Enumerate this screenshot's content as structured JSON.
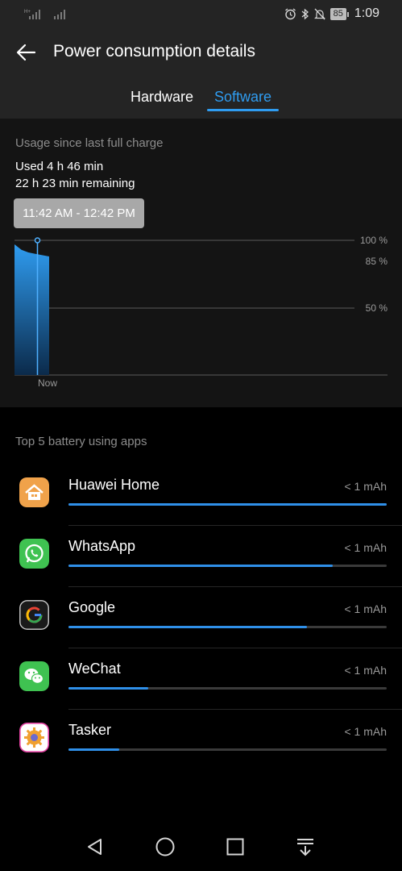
{
  "status_bar": {
    "time": "1:09",
    "battery_level": "85",
    "icons": [
      "signal-icon",
      "signal-icon",
      "alarm-icon",
      "bluetooth-icon",
      "mute-icon",
      "battery-icon"
    ]
  },
  "header": {
    "title": "Power consumption details",
    "back_icon": "back-arrow-icon"
  },
  "tabs": [
    {
      "label": "Hardware",
      "selected": false
    },
    {
      "label": "Software",
      "selected": true
    }
  ],
  "usage": {
    "title": "Usage since last full charge",
    "used": "Used 4 h 46 min",
    "remaining": "22 h 23 min remaining",
    "selected_range": "11:42 AM - 12:42 PM"
  },
  "chart_data": {
    "type": "area",
    "y_ticks": [
      "100 %",
      "85 %",
      "50 %"
    ],
    "x_label": "Now",
    "ylim": [
      0,
      100
    ],
    "series": [
      {
        "values": [
          97,
          93,
          91,
          90,
          89,
          88
        ]
      }
    ],
    "accent": "#2f9cf0"
  },
  "apps": {
    "title": "Top 5 battery using apps",
    "items": [
      {
        "name": "Huawei Home",
        "value": "< 1 mAh",
        "share": 1.0,
        "icon": "home-icon"
      },
      {
        "name": "WhatsApp",
        "value": "< 1 mAh",
        "share": 0.83,
        "icon": "whatsapp-icon"
      },
      {
        "name": "Google",
        "value": "< 1 mAh",
        "share": 0.75,
        "icon": "google-icon"
      },
      {
        "name": "WeChat",
        "value": "< 1 mAh",
        "share": 0.25,
        "icon": "wechat-icon"
      },
      {
        "name": "Tasker",
        "value": "< 1 mAh",
        "share": 0.16,
        "icon": "tasker-icon"
      }
    ]
  },
  "nav": {
    "buttons": [
      "back-icon",
      "home-icon",
      "recents-icon",
      "notification-pull-icon"
    ]
  }
}
